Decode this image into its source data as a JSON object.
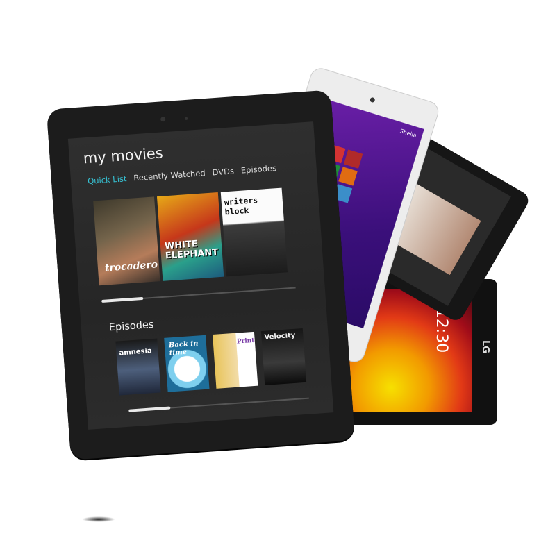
{
  "main_tablet": {
    "title": "my movies",
    "tabs": [
      "Quick List",
      "Recently Watched",
      "DVDs",
      "Episodes"
    ],
    "window_controls": [
      "⚙",
      "—",
      "✕"
    ],
    "row1_posters": [
      "trocadero",
      "WHITE ELEPHANT",
      "writers block"
    ],
    "section2_title": "Episodes",
    "row2_posters": [
      "amnesia",
      "Back in time",
      "Printemp",
      "Velocity"
    ],
    "row1_scroll_fraction": 0.22,
    "row2_scroll_fraction": 0.22
  },
  "windows_tablet": {
    "user_name": "Sheila"
  },
  "lg_tablet": {
    "clock": "12:30",
    "logo": "LG"
  },
  "colors": {
    "accent": "#36c4d6"
  }
}
